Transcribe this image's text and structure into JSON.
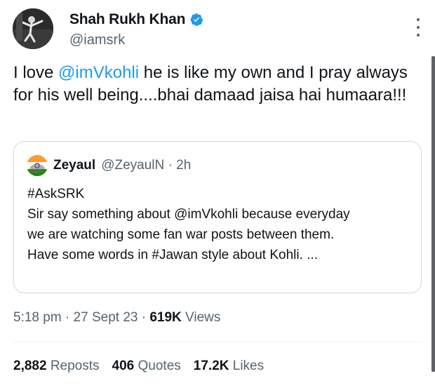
{
  "author": {
    "display_name": "Shah Rukh Khan",
    "handle": "@iamsrk",
    "verified_icon": "verified-badge-icon"
  },
  "tweet": {
    "part1": "I love ",
    "mention": "@imVkohli",
    "part2": " he is like my own and I pray always for his well being....bhai damaad jaisa hai humaara!!!"
  },
  "quote": {
    "name": "Zeyaul",
    "handle": "@ZeyaulN",
    "sep": " · ",
    "time": "2h",
    "lines": [
      "#AskSRK",
      "Sir say something about @imVkohli because everyday",
      "we are watching some fan war posts between them."
    ],
    "last_line": "Have some words in #Jawan style about Kohli. ..."
  },
  "meta": {
    "time": "5:18 pm",
    "sep1": " · ",
    "date": "27 Sept 23",
    "sep2": " · ",
    "views_count": "619K",
    "views_label": " Views"
  },
  "stats": {
    "reposts_count": "2,882",
    "reposts_label": " Reposts",
    "quotes_count": "406",
    "quotes_label": " Quotes",
    "likes_count": "17.2K",
    "likes_label": " Likes"
  },
  "colors": {
    "accent": "#1d9bf0",
    "secondary_text": "#536471",
    "border": "#cfd9de"
  }
}
